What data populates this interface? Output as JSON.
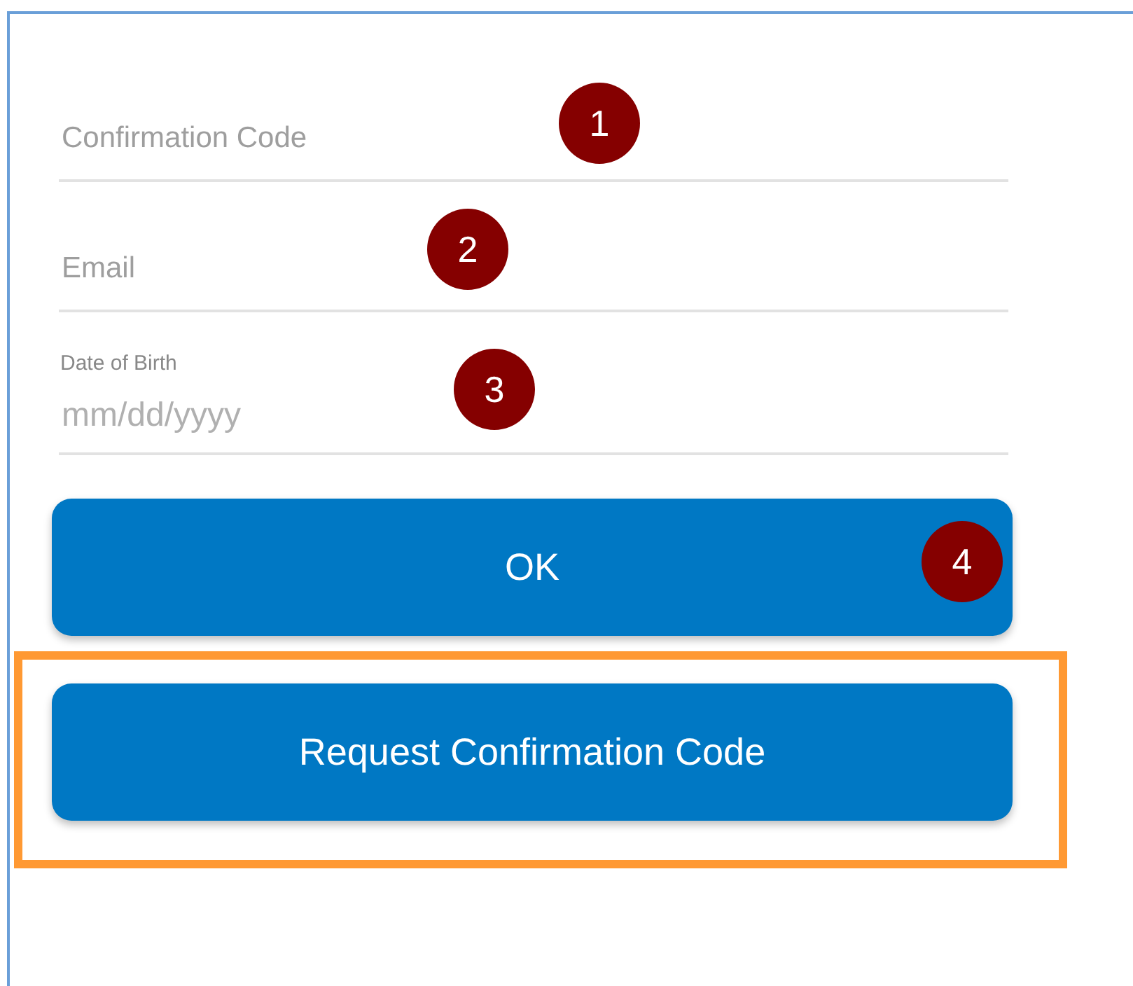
{
  "fields": [
    {
      "kind": "text",
      "placeholder": "Confirmation Code",
      "badge": "1"
    },
    {
      "kind": "text",
      "placeholder": "Email",
      "badge": "2"
    },
    {
      "kind": "date",
      "label": "Date of Birth",
      "placeholder": "mm/dd/yyyy",
      "badge": "3"
    }
  ],
  "buttons": [
    {
      "label": "OK",
      "badge": "4",
      "highlighted": false
    },
    {
      "label": "Request Confirmation Code",
      "highlighted": true
    }
  ]
}
